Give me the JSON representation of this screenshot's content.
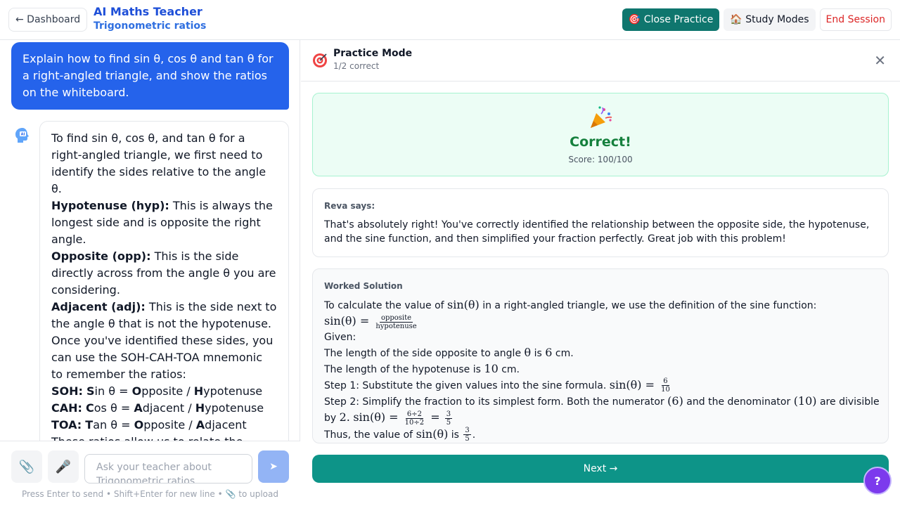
{
  "header": {
    "back_label": "← Dashboard",
    "title": "AI Maths Teacher",
    "subtitle": "Trigonometric ratios",
    "close_practice_label": "🎯 Close Practice",
    "study_modes_label": "🏠 Study Modes",
    "end_session_label": "End Session"
  },
  "chat": {
    "user_message": "Explain how to find sin θ, cos θ and tan θ for a right-angled triangle, and show the ratios on the whiteboard.",
    "ai_intro": "To find sin θ, cos θ, and tan θ for a right-angled triangle, we first need to identify the sides relative to the angle θ.",
    "hyp_term": "Hypotenuse (hyp):",
    "hyp_text": " This is always the longest side and is opposite the right angle.",
    "opp_term": "Opposite (opp):",
    "opp_text": " This is the side directly across from the angle θ you are considering.",
    "adj_term": "Adjacent (adj):",
    "adj_text": " This is the side next to the angle θ that is not the hypotenuse.",
    "mnemonic_text": "Once you've identified these sides, you can use the SOH-CAH-TOA mnemonic to remember the ratios:",
    "soh_label": "SOH:",
    "soh_s": "S",
    "soh_rest1": "in θ = ",
    "soh_o": "O",
    "soh_rest2": "pposite / ",
    "soh_h": "H",
    "soh_rest3": "ypotenuse",
    "cah_label": "CAH:",
    "cah_c": "C",
    "cah_rest1": "os θ = ",
    "cah_a": "A",
    "cah_rest2": "djacent / ",
    "cah_h": "H",
    "cah_rest3": "ypotenuse",
    "toa_label": "TOA:",
    "toa_t": "T",
    "toa_rest1": "an θ = ",
    "toa_o": "O",
    "toa_rest2": "pposite / ",
    "toa_a": "A",
    "toa_rest3": "djacent",
    "ai_trailing": "These ratios allow us to relate the"
  },
  "composer": {
    "attach_icon": "📎",
    "mic_icon": "🎤",
    "placeholder": "Ask your teacher about Trigonometric ratios",
    "send_icon": "➤",
    "hint": "Press Enter to send • Shift+Enter for new line • 📎 to upload"
  },
  "practice": {
    "mode_title": "Practice Mode",
    "score_text": "1/2 correct",
    "close_icon": "✕",
    "result_title": "Correct!",
    "result_score": "Score: 100/100",
    "feedback_label": "Reva says:",
    "feedback_text": "That's absolutely right! You've correctly identified the relationship between the opposite side, the hypotenuse, and the sine function, and then simplified your fraction perfectly. Great job with this problem!",
    "solution_label": "Worked Solution",
    "sol_line1": "To calculate the value of ",
    "sol_line1_end": " in a right-angled triangle, we use the definition of the sine function:",
    "sin_theta": "sin(θ)",
    "eq": " = ",
    "frac_opposite": "opposite",
    "frac_hypotenuse": "hypotenuse",
    "given": "Given:",
    "sol_line4a": "The length of the side opposite to angle ",
    "theta": "θ",
    "sol_line4b": " is ",
    "six": "6",
    "cm_dot": " cm.",
    "sol_line5a": "The length of the hypotenuse is ",
    "ten": "10",
    "step1": "Step 1: Substitute the given values into the sine formula. ",
    "step2a": "Step 2: Simplify the fraction to its simplest form. Both the numerator ",
    "six_paren": "(6)",
    "step2b": " and the denominator ",
    "ten_paren": "(10)",
    "step2c": " are divisible",
    "by_text": "by ",
    "two_dot": "2.",
    "frac_6div2": "6÷2",
    "frac_10div2": "10÷2",
    "three": "3",
    "five": "5",
    "thus_a": "Thus, the value of ",
    "thus_b": " is ",
    "dot": ".",
    "next_label": "Next →"
  },
  "help": {
    "label": "?"
  }
}
